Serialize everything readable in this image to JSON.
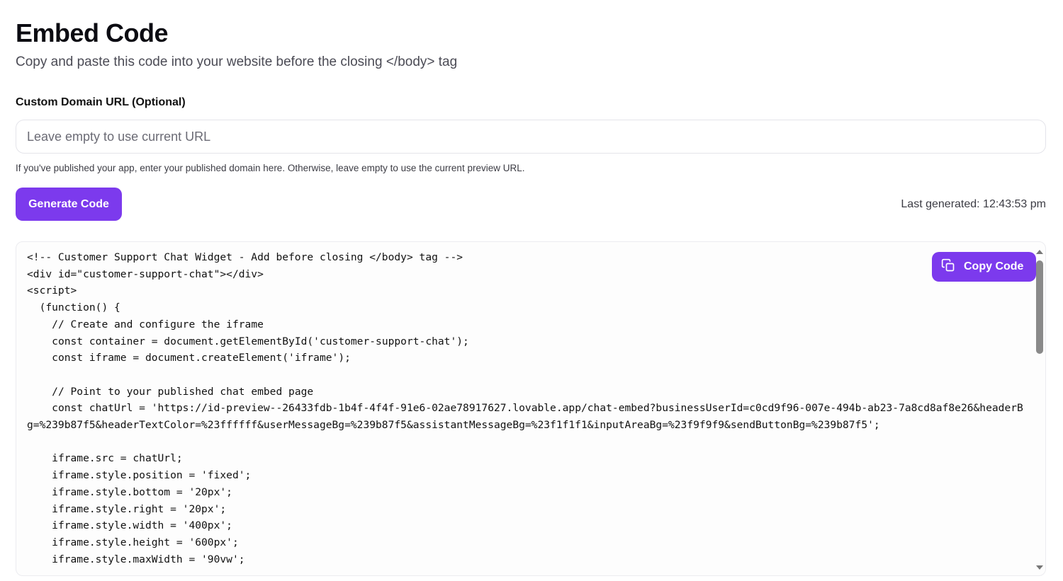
{
  "header": {
    "title": "Embed Code",
    "subtitle": "Copy and paste this code into your website before the closing </body> tag"
  },
  "domain": {
    "label": "Custom Domain URL (Optional)",
    "value": "",
    "placeholder": "Leave empty to use current URL",
    "help": "If you've published your app, enter your published domain here. Otherwise, leave empty to use the current preview URL."
  },
  "actions": {
    "generate_label": "Generate Code",
    "last_generated": "Last generated: 12:43:53 pm",
    "copy_label": "Copy Code"
  },
  "icons": {
    "copy": "copy-icon"
  },
  "colors": {
    "accent": "#7c3aed"
  },
  "code": "<!-- Customer Support Chat Widget - Add before closing </body> tag -->\n<div id=\"customer-support-chat\"></div>\n<script>\n  (function() {\n    // Create and configure the iframe\n    const container = document.getElementById('customer-support-chat');\n    const iframe = document.createElement('iframe');\n\n    // Point to your published chat embed page\n    const chatUrl = 'https://id-preview--26433fdb-1b4f-4f4f-91e6-02ae78917627.lovable.app/chat-embed?businessUserId=c0cd9f96-007e-494b-ab23-7a8cd8af8e26&headerBg=%239b87f5&headerTextColor=%23ffffff&userMessageBg=%239b87f5&assistantMessageBg=%23f1f1f1&inputAreaBg=%23f9f9f9&sendButtonBg=%239b87f5';\n\n    iframe.src = chatUrl;\n    iframe.style.position = 'fixed';\n    iframe.style.bottom = '20px';\n    iframe.style.right = '20px';\n    iframe.style.width = '400px';\n    iframe.style.height = '600px';\n    iframe.style.maxWidth = '90vw';"
}
